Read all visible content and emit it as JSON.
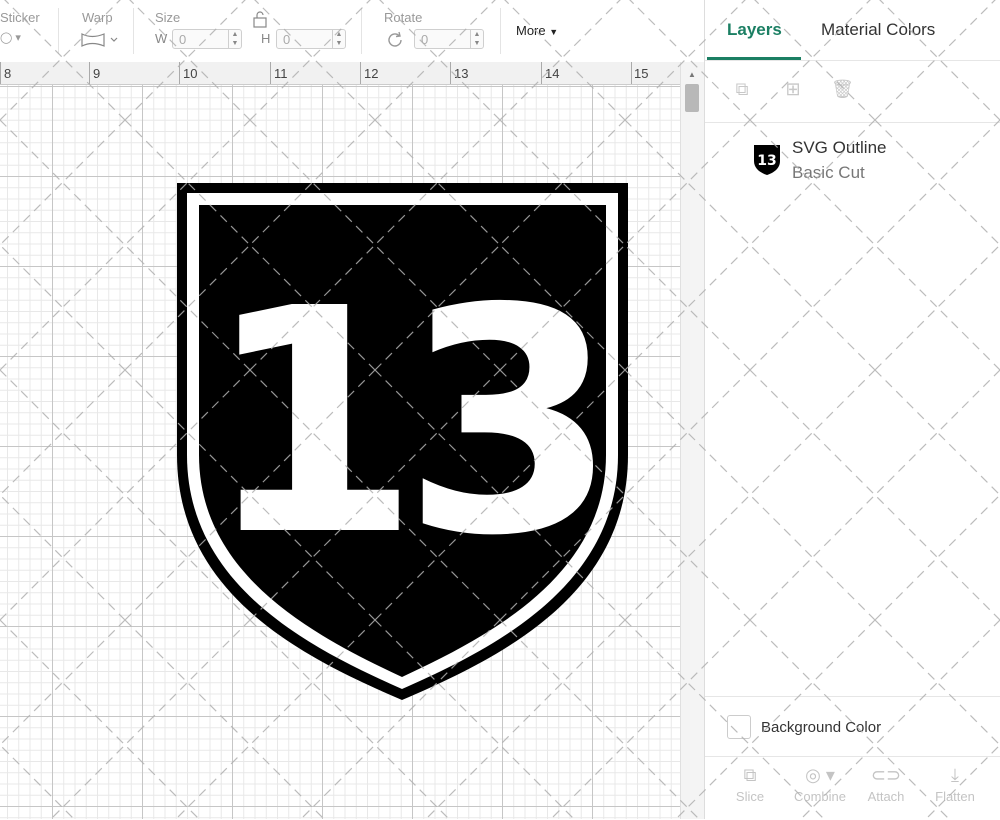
{
  "toolbar": {
    "sticker_label": "Sticker",
    "warp_label": "Warp",
    "size_label": "Size",
    "width_letter": "W",
    "width_value": "0",
    "height_letter": "H",
    "height_value": "0",
    "rotate_label": "Rotate",
    "rotate_value": "0",
    "more_label": "More"
  },
  "ruler": {
    "numbers": [
      "8",
      "9",
      "10",
      "11",
      "12",
      "13",
      "14",
      "15"
    ]
  },
  "canvas": {
    "design_text": "13"
  },
  "panel": {
    "tabs": [
      {
        "label": "Layers"
      },
      {
        "label": "Material Colors"
      }
    ],
    "layer": {
      "thumb_text": "13",
      "name": "SVG Outline",
      "operation": "Basic Cut"
    },
    "background_color_label": "Background Color",
    "bottom_buttons": [
      {
        "label": "Slice"
      },
      {
        "label": "Combine"
      },
      {
        "label": "Attach"
      },
      {
        "label": "Flatten"
      }
    ]
  },
  "colors": {
    "accent": "#1b7f63",
    "design": "#000000"
  }
}
